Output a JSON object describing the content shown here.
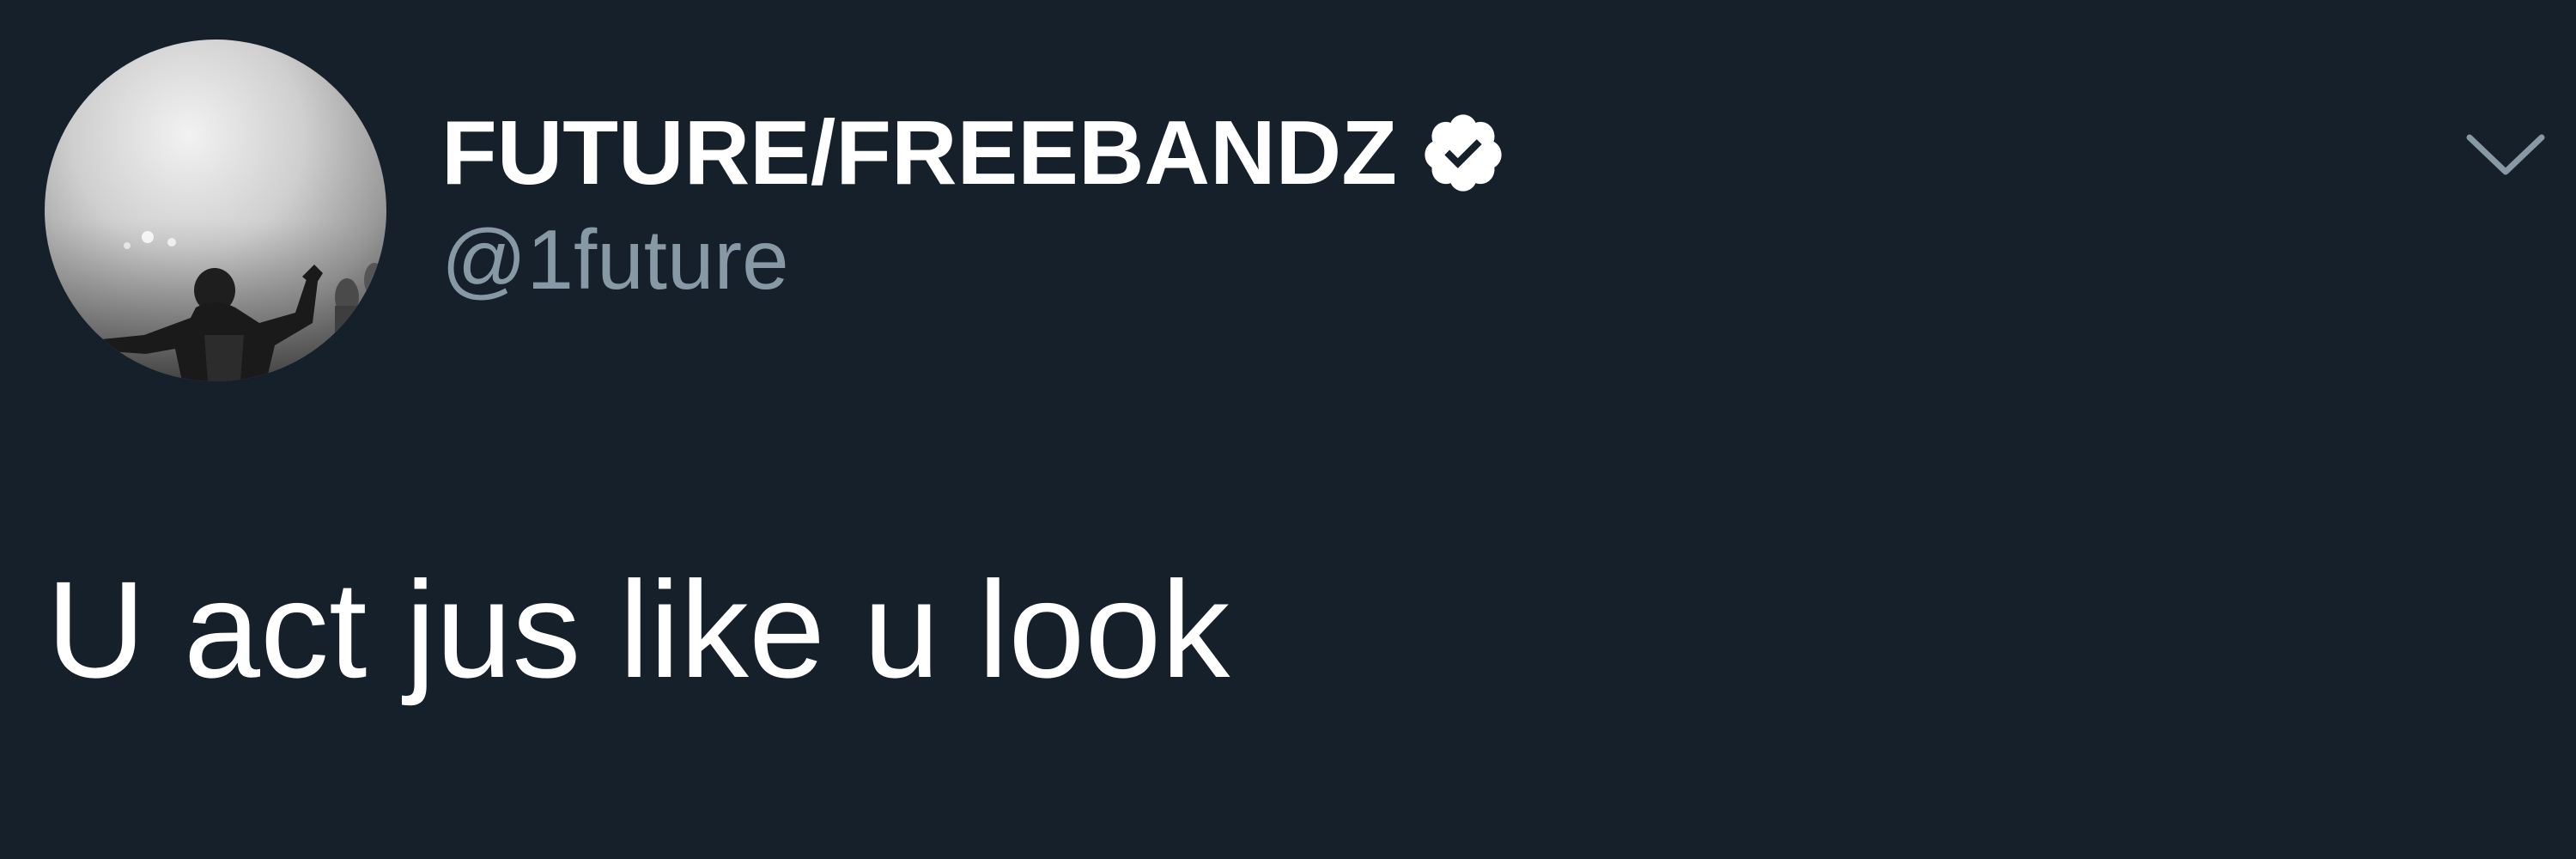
{
  "theme": {
    "background": "#15202b",
    "primary_text": "#ffffff",
    "secondary_text": "#8899a6"
  },
  "tweet": {
    "author": {
      "display_name": "FUTURE/FREEBANDZ",
      "handle": "@1future",
      "verified": true,
      "avatar_icon": "profile-photo-grayscale-performer"
    },
    "menu_icon": "chevron-down-icon",
    "text": "U act jus like u look"
  }
}
